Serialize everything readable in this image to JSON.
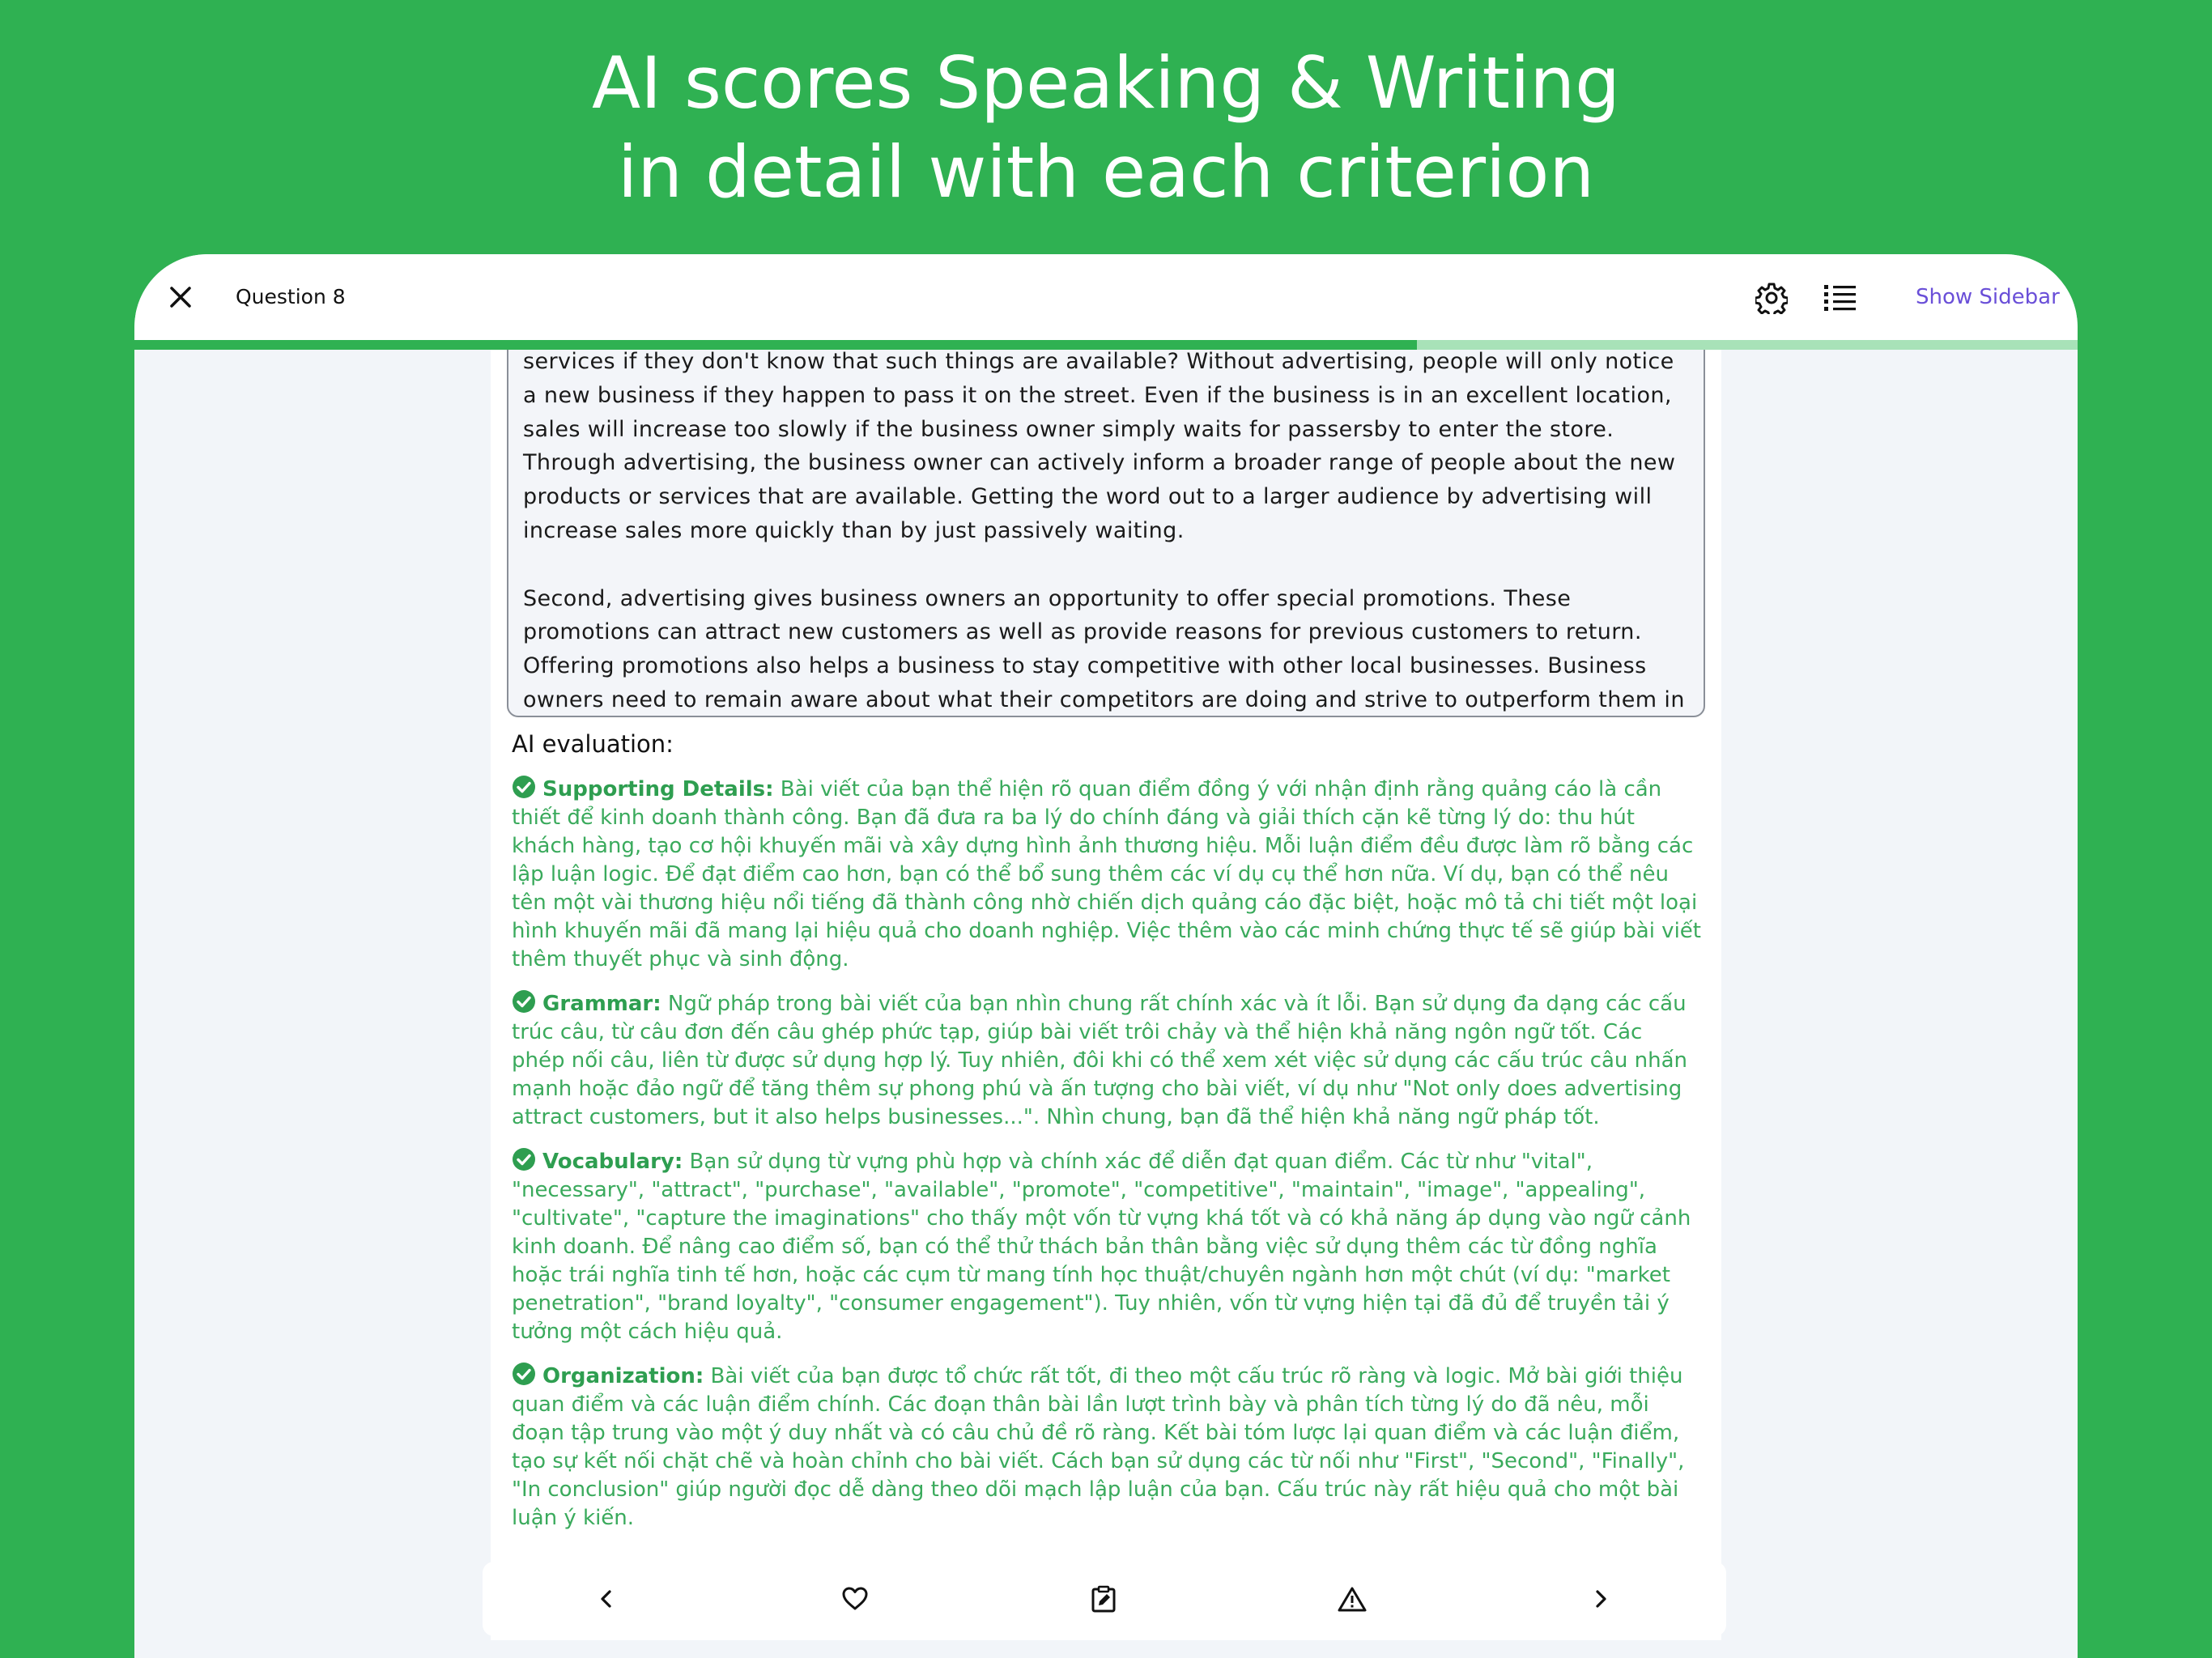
{
  "headline": {
    "line1": "AI scores Speaking & Writing",
    "line2": "in detail with each criterion"
  },
  "topbar": {
    "close_icon": "close-icon",
    "title": "Question 8",
    "settings_icon": "gear-icon",
    "question_list_icon": "numbered-list-icon",
    "sidebar_label": "Show Sidebar",
    "progress": 0.66
  },
  "essay": {
    "paragraph1": "services if they don't know that such things are available? Without advertising, people will only notice a new business if they happen to pass it on the street. Even if the business is in an excellent location, sales will increase too slowly if the business owner simply waits for passersby to enter the store. Through advertising, the business owner can actively inform a broader range of people about the new products or services that are available. Getting the word out to a larger audience by advertising will increase sales more quickly than by just passively waiting.",
    "paragraph2": "Second, advertising gives business owners an opportunity to offer special promotions. These promotions can attract new customers as well as provide reasons for previous customers to return. Offering promotions also helps a business to stay competitive with other local businesses. Business owners need to remain aware about what their competitors are doing and strive to outperform them in"
  },
  "evaluation": {
    "heading": "AI evaluation:",
    "criteria": [
      {
        "name": "Supporting Details:",
        "text": " Bài viết của bạn thể hiện rõ quan điểm đồng ý với nhận định rằng quảng cáo là cần thiết để kinh doanh thành công. Bạn đã đưa ra ba lý do chính đáng và giải thích cặn kẽ từng lý do: thu hút khách hàng, tạo cơ hội khuyến mãi và xây dựng hình ảnh thương hiệu. Mỗi luận điểm đều được làm rõ bằng các lập luận logic. Để đạt điểm cao hơn, bạn có thể bổ sung thêm các ví dụ cụ thể hơn nữa. Ví dụ, bạn có thể nêu tên một vài thương hiệu nổi tiếng đã thành công nhờ chiến dịch quảng cáo đặc biệt, hoặc mô tả chi tiết một loại hình khuyến mãi đã mang lại hiệu quả cho doanh nghiệp. Việc thêm vào các minh chứng thực tế sẽ giúp bài viết thêm thuyết phục và sinh động."
      },
      {
        "name": "Grammar:",
        "text": " Ngữ pháp trong bài viết của bạn nhìn chung rất chính xác và ít lỗi. Bạn sử dụng đa dạng các cấu trúc câu, từ câu đơn đến câu ghép phức tạp, giúp bài viết trôi chảy và thể hiện khả năng ngôn ngữ tốt. Các phép nối câu, liên từ được sử dụng hợp lý. Tuy nhiên, đôi khi có thể xem xét việc sử dụng các cấu trúc câu nhấn mạnh hoặc đảo ngữ để tăng thêm sự phong phú và ấn tượng cho bài viết, ví dụ như \"Not only does advertising attract customers, but it also helps businesses...\". Nhìn chung, bạn đã thể hiện khả năng ngữ pháp tốt."
      },
      {
        "name": "Vocabulary:",
        "text": " Bạn sử dụng từ vựng phù hợp và chính xác để diễn đạt quan điểm. Các từ như \"vital\", \"necessary\", \"attract\", \"purchase\", \"available\", \"promote\", \"competitive\", \"maintain\", \"image\", \"appealing\", \"cultivate\", \"capture the imaginations\" cho thấy một vốn từ vựng khá tốt và có khả năng áp dụng vào ngữ cảnh kinh doanh. Để nâng cao điểm số, bạn có thể thử thách bản thân bằng việc sử dụng thêm các từ đồng nghĩa hoặc trái nghĩa tinh tế hơn, hoặc các cụm từ mang tính học thuật/chuyên ngành hơn một chút (ví dụ: \"market penetration\", \"brand loyalty\", \"consumer engagement\"). Tuy nhiên, vốn từ vựng hiện tại đã đủ để truyền tải ý tưởng một cách hiệu quả."
      },
      {
        "name": "Organization:",
        "text": " Bài viết của bạn được tổ chức rất tốt, đi theo một cấu trúc rõ ràng và logic. Mở bài giới thiệu quan điểm và các luận điểm chính. Các đoạn thân bài lần lượt trình bày và phân tích từng lý do đã nêu, mỗi đoạn tập trung vào một ý duy nhất và có câu chủ đề rõ ràng. Kết bài tóm lược lại quan điểm và các luận điểm, tạo sự kết nối chặt chẽ và hoàn chỉnh cho bài viết. Cách bạn sử dụng các từ nối như \"First\", \"Second\", \"Finally\", \"In conclusion\" giúp người đọc dễ dàng theo dõi mạch lập luận của bạn. Cấu trúc này rất hiệu quả cho một bài luận ý kiến."
      }
    ]
  },
  "bottom_nav": {
    "prev_icon": "chevron-left-icon",
    "favorite_icon": "heart-icon",
    "note_icon": "edit-note-icon",
    "report_icon": "warning-icon",
    "next_icon": "chevron-right-icon"
  },
  "colors": {
    "background": "#2fb152",
    "accent": "#6a4fd8",
    "evaluation_text": "#3aaa5c"
  }
}
